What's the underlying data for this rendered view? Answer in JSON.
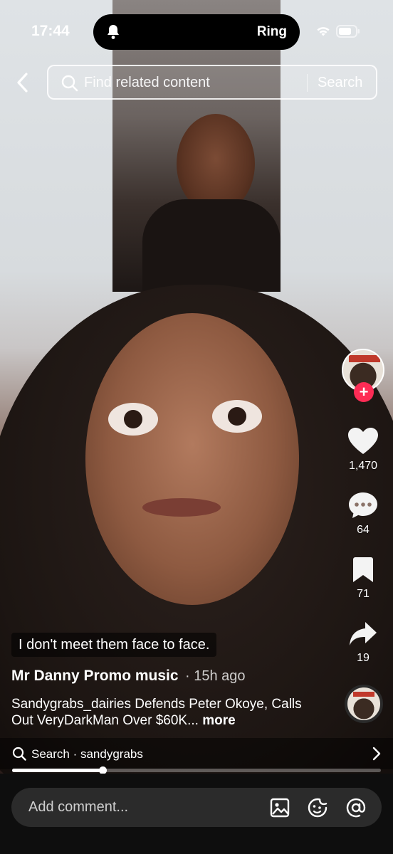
{
  "status_bar": {
    "time": "17:44",
    "island_label": "Ring"
  },
  "search": {
    "placeholder": "Find related content",
    "button_label": "Search"
  },
  "rail": {
    "likes": "1,470",
    "comments": "64",
    "saves": "71",
    "shares": "19",
    "follow_label": "+"
  },
  "caption": {
    "subtitle": "I don't meet them face to face.",
    "author": "Mr Danny Promo music",
    "time_ago": "· 15h ago",
    "description": "Sandygrabs_dairies Defends Peter Okoye, Calls Out VeryDarkMan Over $60K...",
    "more": "more"
  },
  "search_strip": {
    "text": "Search · sandygrabs"
  },
  "progress": {
    "fraction": 0.245
  },
  "comment_bar": {
    "placeholder": "Add comment..."
  },
  "colors": {
    "accent": "#fe2c55"
  }
}
